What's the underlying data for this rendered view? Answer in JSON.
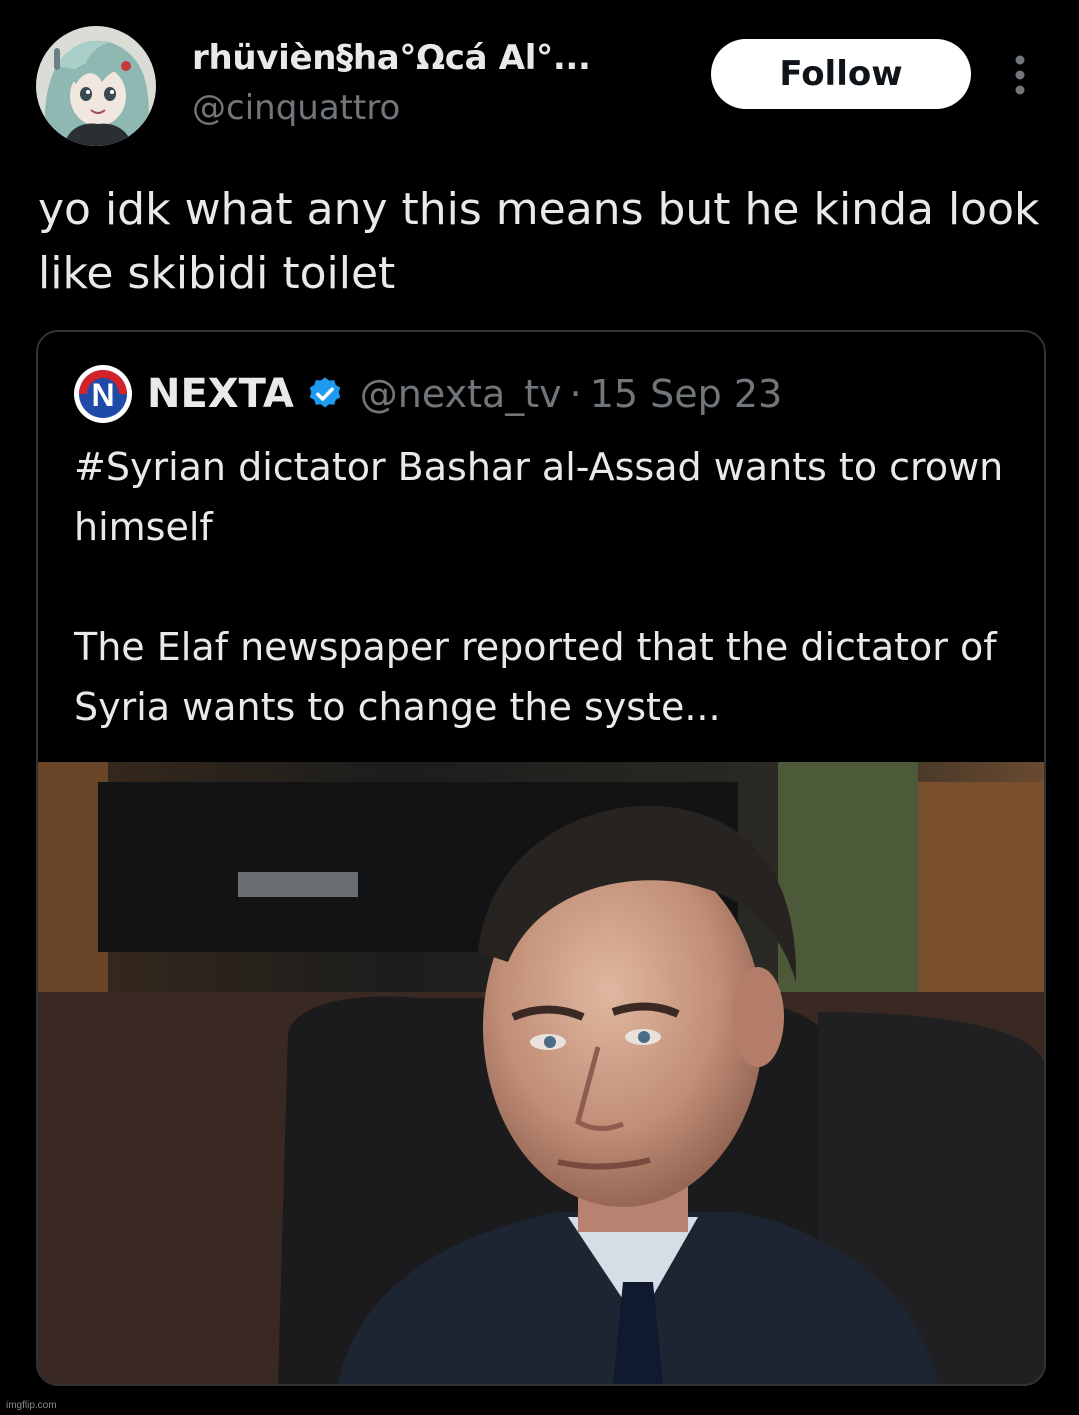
{
  "author": {
    "display_name": "rhüvièn§ha°Ωcá Al°...",
    "handle": "@cinquattro",
    "avatar_icon": "anime-avatar-icon"
  },
  "actions": {
    "follow_label": "Follow",
    "more_icon": "more-vertical-icon"
  },
  "tweet": {
    "text": "yo idk what any this means but he kinda look like skibidi toilet"
  },
  "quoted_tweet": {
    "name": "NEXTA",
    "verified_icon": "verified-badge-icon",
    "logo_icon": "nexta-logo-icon",
    "handle": "@nexta_tv",
    "separator": "·",
    "date": "15 Sep 23",
    "paragraph_1": "#Syrian dictator Bashar al-Assad wants to crown himself",
    "paragraph_2": "The Elaf newspaper reported that the dictator of Syria wants to change the syste...",
    "media": "photo-man-in-suit"
  },
  "watermark": {
    "text": "imgflip.com"
  },
  "colors": {
    "background": "#000000",
    "primary_text": "#e7e9ea",
    "secondary_text": "#71767b",
    "border": "#2f3336",
    "verified_blue": "#1d9bf0",
    "follow_bg": "#ffffff",
    "nexta_red": "#d3232a",
    "nexta_blue": "#1f4aa8"
  }
}
